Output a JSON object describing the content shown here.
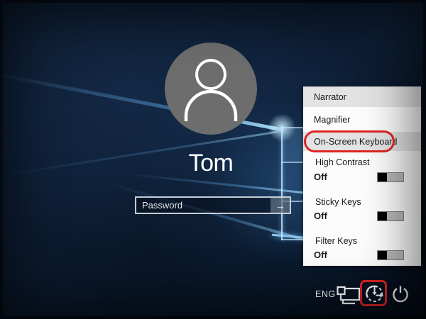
{
  "login": {
    "username": "Tom",
    "password_placeholder": "Password",
    "submit_glyph": "→"
  },
  "ease_of_access_menu": {
    "items": [
      {
        "label": "Narrator"
      },
      {
        "label": "Magnifier"
      },
      {
        "label": "On-Screen Keyboard"
      }
    ],
    "toggles": [
      {
        "label": "High Contrast",
        "state": "Off"
      },
      {
        "label": "Sticky Keys",
        "state": "Off"
      },
      {
        "label": "Filter Keys",
        "state": "Off"
      }
    ]
  },
  "tray": {
    "language": "ENG"
  },
  "annotation": {
    "color": "#e02424"
  }
}
